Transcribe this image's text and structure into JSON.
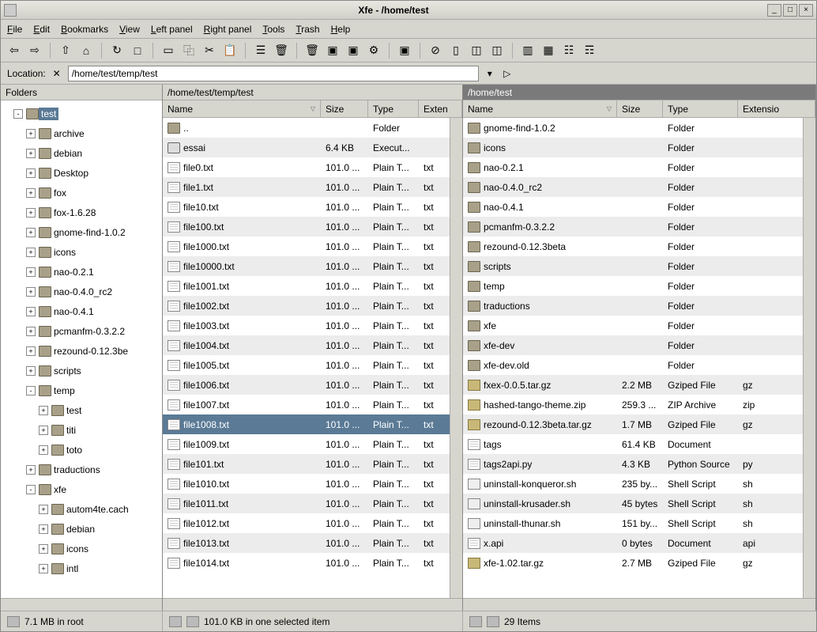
{
  "window": {
    "title": "Xfe - /home/test",
    "min": "_",
    "max": "□",
    "close": "×"
  },
  "menu": [
    "File",
    "Edit",
    "Bookmarks",
    "View",
    "Left panel",
    "Right panel",
    "Tools",
    "Trash",
    "Help"
  ],
  "location": {
    "label": "Location:",
    "path": "/home/test/temp/test"
  },
  "folders": {
    "title": "Folders",
    "items": [
      {
        "indent": 1,
        "name": "test",
        "exp": "-",
        "selected": true
      },
      {
        "indent": 2,
        "name": "archive",
        "exp": "+"
      },
      {
        "indent": 2,
        "name": "debian",
        "exp": "+"
      },
      {
        "indent": 2,
        "name": "Desktop",
        "exp": "+"
      },
      {
        "indent": 2,
        "name": "fox",
        "exp": "+"
      },
      {
        "indent": 2,
        "name": "fox-1.6.28",
        "exp": "+"
      },
      {
        "indent": 2,
        "name": "gnome-find-1.0.2",
        "exp": "+"
      },
      {
        "indent": 2,
        "name": "icons",
        "exp": "+"
      },
      {
        "indent": 2,
        "name": "nao-0.2.1",
        "exp": "+"
      },
      {
        "indent": 2,
        "name": "nao-0.4.0_rc2",
        "exp": "+"
      },
      {
        "indent": 2,
        "name": "nao-0.4.1",
        "exp": "+"
      },
      {
        "indent": 2,
        "name": "pcmanfm-0.3.2.2",
        "exp": "+"
      },
      {
        "indent": 2,
        "name": "rezound-0.12.3be",
        "exp": "+"
      },
      {
        "indent": 2,
        "name": "scripts",
        "exp": "+"
      },
      {
        "indent": 2,
        "name": "temp",
        "exp": "-"
      },
      {
        "indent": 3,
        "name": "test",
        "exp": "+"
      },
      {
        "indent": 3,
        "name": "titi",
        "exp": "+"
      },
      {
        "indent": 3,
        "name": "toto",
        "exp": "+"
      },
      {
        "indent": 2,
        "name": "traductions",
        "exp": "+"
      },
      {
        "indent": 2,
        "name": "xfe",
        "exp": "-"
      },
      {
        "indent": 3,
        "name": "autom4te.cach",
        "exp": "+"
      },
      {
        "indent": 3,
        "name": "debian",
        "exp": "+"
      },
      {
        "indent": 3,
        "name": "icons",
        "exp": "+"
      },
      {
        "indent": 3,
        "name": "intl",
        "exp": "+"
      }
    ]
  },
  "left": {
    "path": "/home/test/temp/test",
    "cols": {
      "name": "Name",
      "size": "Size",
      "type": "Type",
      "ext": "Exten"
    },
    "colw": {
      "name": 200,
      "size": 60,
      "type": 64,
      "ext": 50
    },
    "rows": [
      {
        "icon": "folder",
        "name": "..",
        "size": "",
        "type": "Folder",
        "ext": ""
      },
      {
        "icon": "exec",
        "name": "essai",
        "size": "6.4 KB",
        "type": "Execut...",
        "ext": ""
      },
      {
        "icon": "file",
        "name": "file0.txt",
        "size": "101.0 ...",
        "type": "Plain T...",
        "ext": "txt"
      },
      {
        "icon": "file",
        "name": "file1.txt",
        "size": "101.0 ...",
        "type": "Plain T...",
        "ext": "txt"
      },
      {
        "icon": "file",
        "name": "file10.txt",
        "size": "101.0 ...",
        "type": "Plain T...",
        "ext": "txt"
      },
      {
        "icon": "file",
        "name": "file100.txt",
        "size": "101.0 ...",
        "type": "Plain T...",
        "ext": "txt"
      },
      {
        "icon": "file",
        "name": "file1000.txt",
        "size": "101.0 ...",
        "type": "Plain T...",
        "ext": "txt"
      },
      {
        "icon": "file",
        "name": "file10000.txt",
        "size": "101.0 ...",
        "type": "Plain T...",
        "ext": "txt"
      },
      {
        "icon": "file",
        "name": "file1001.txt",
        "size": "101.0 ...",
        "type": "Plain T...",
        "ext": "txt"
      },
      {
        "icon": "file",
        "name": "file1002.txt",
        "size": "101.0 ...",
        "type": "Plain T...",
        "ext": "txt"
      },
      {
        "icon": "file",
        "name": "file1003.txt",
        "size": "101.0 ...",
        "type": "Plain T...",
        "ext": "txt"
      },
      {
        "icon": "file",
        "name": "file1004.txt",
        "size": "101.0 ...",
        "type": "Plain T...",
        "ext": "txt"
      },
      {
        "icon": "file",
        "name": "file1005.txt",
        "size": "101.0 ...",
        "type": "Plain T...",
        "ext": "txt"
      },
      {
        "icon": "file",
        "name": "file1006.txt",
        "size": "101.0 ...",
        "type": "Plain T...",
        "ext": "txt"
      },
      {
        "icon": "file",
        "name": "file1007.txt",
        "size": "101.0 ...",
        "type": "Plain T...",
        "ext": "txt"
      },
      {
        "icon": "file",
        "name": "file1008.txt",
        "size": "101.0 ...",
        "type": "Plain T...",
        "ext": "txt",
        "selected": true
      },
      {
        "icon": "file",
        "name": "file1009.txt",
        "size": "101.0 ...",
        "type": "Plain T...",
        "ext": "txt"
      },
      {
        "icon": "file",
        "name": "file101.txt",
        "size": "101.0 ...",
        "type": "Plain T...",
        "ext": "txt"
      },
      {
        "icon": "file",
        "name": "file1010.txt",
        "size": "101.0 ...",
        "type": "Plain T...",
        "ext": "txt"
      },
      {
        "icon": "file",
        "name": "file1011.txt",
        "size": "101.0 ...",
        "type": "Plain T...",
        "ext": "txt"
      },
      {
        "icon": "file",
        "name": "file1012.txt",
        "size": "101.0 ...",
        "type": "Plain T...",
        "ext": "txt"
      },
      {
        "icon": "file",
        "name": "file1013.txt",
        "size": "101.0 ...",
        "type": "Plain T...",
        "ext": "txt"
      },
      {
        "icon": "file",
        "name": "file1014.txt",
        "size": "101.0 ...",
        "type": "Plain T...",
        "ext": "txt"
      }
    ]
  },
  "right": {
    "path": "/home/test",
    "cols": {
      "name": "Name",
      "size": "Size",
      "type": "Type",
      "ext": "Extensio"
    },
    "colw": {
      "name": 195,
      "size": 58,
      "type": 95,
      "ext": 70
    },
    "rows": [
      {
        "icon": "folder",
        "name": "gnome-find-1.0.2",
        "size": "",
        "type": "Folder",
        "ext": ""
      },
      {
        "icon": "folder",
        "name": "icons",
        "size": "",
        "type": "Folder",
        "ext": ""
      },
      {
        "icon": "folder",
        "name": "nao-0.2.1",
        "size": "",
        "type": "Folder",
        "ext": ""
      },
      {
        "icon": "folder",
        "name": "nao-0.4.0_rc2",
        "size": "",
        "type": "Folder",
        "ext": ""
      },
      {
        "icon": "folder",
        "name": "nao-0.4.1",
        "size": "",
        "type": "Folder",
        "ext": ""
      },
      {
        "icon": "folder",
        "name": "pcmanfm-0.3.2.2",
        "size": "",
        "type": "Folder",
        "ext": ""
      },
      {
        "icon": "folder",
        "name": "rezound-0.12.3beta",
        "size": "",
        "type": "Folder",
        "ext": ""
      },
      {
        "icon": "folder",
        "name": "scripts",
        "size": "",
        "type": "Folder",
        "ext": ""
      },
      {
        "icon": "folder",
        "name": "temp",
        "size": "",
        "type": "Folder",
        "ext": ""
      },
      {
        "icon": "folder",
        "name": "traductions",
        "size": "",
        "type": "Folder",
        "ext": ""
      },
      {
        "icon": "folder",
        "name": "xfe",
        "size": "",
        "type": "Folder",
        "ext": ""
      },
      {
        "icon": "folder",
        "name": "xfe-dev",
        "size": "",
        "type": "Folder",
        "ext": ""
      },
      {
        "icon": "folder",
        "name": "xfe-dev.old",
        "size": "",
        "type": "Folder",
        "ext": ""
      },
      {
        "icon": "archive",
        "name": "fxex-0.0.5.tar.gz",
        "size": "2.2 MB",
        "type": "Gziped File",
        "ext": "gz"
      },
      {
        "icon": "archive",
        "name": "hashed-tango-theme.zip",
        "size": "259.3 ...",
        "type": "ZIP Archive",
        "ext": "zip"
      },
      {
        "icon": "archive",
        "name": "rezound-0.12.3beta.tar.gz",
        "size": "1.7 MB",
        "type": "Gziped File",
        "ext": "gz"
      },
      {
        "icon": "file",
        "name": "tags",
        "size": "61.4 KB",
        "type": "Document",
        "ext": ""
      },
      {
        "icon": "file",
        "name": "tags2api.py",
        "size": "4.3 KB",
        "type": "Python Source",
        "ext": "py"
      },
      {
        "icon": "script",
        "name": "uninstall-konqueror.sh",
        "size": "235 by...",
        "type": "Shell Script",
        "ext": "sh"
      },
      {
        "icon": "script",
        "name": "uninstall-krusader.sh",
        "size": "45 bytes",
        "type": "Shell Script",
        "ext": "sh"
      },
      {
        "icon": "script",
        "name": "uninstall-thunar.sh",
        "size": "151 by...",
        "type": "Shell Script",
        "ext": "sh"
      },
      {
        "icon": "file",
        "name": "x.api",
        "size": "0 bytes",
        "type": "Document",
        "ext": "api"
      },
      {
        "icon": "archive",
        "name": "xfe-1.02.tar.gz",
        "size": "2.7 MB",
        "type": "Gziped File",
        "ext": "gz"
      }
    ]
  },
  "status": {
    "folders": "7.1 MB in root",
    "left": "101.0 KB in one selected item",
    "right": "29 Items"
  },
  "toolbar_icons": [
    "back",
    "fwd",
    "up",
    "home",
    "refresh",
    "newfile",
    "newfolder",
    "copy",
    "cut",
    "paste",
    "props",
    "trash1",
    "trash2",
    "app1",
    "app2",
    "app3",
    "app4",
    "link",
    "panel1",
    "panel2",
    "panel3",
    "panel4",
    "view1",
    "view2",
    "view3"
  ]
}
